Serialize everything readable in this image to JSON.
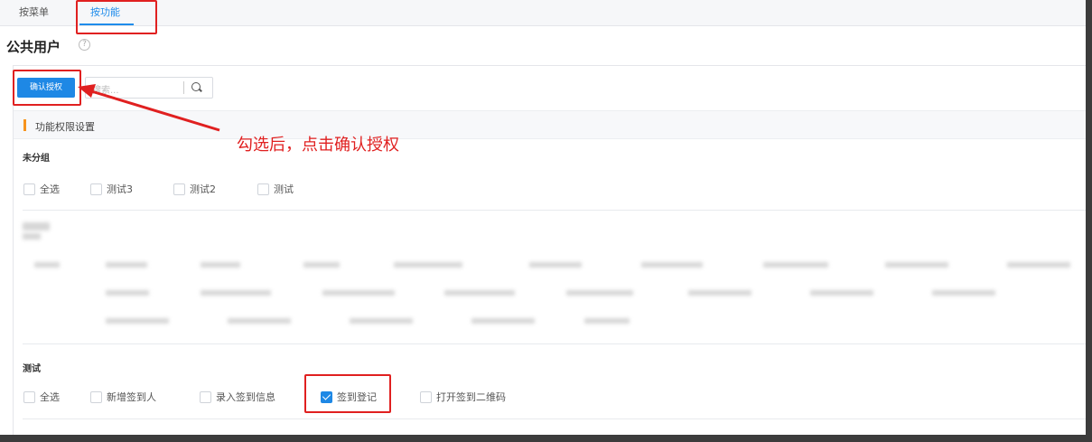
{
  "tabs": [
    {
      "label": "按菜单"
    },
    {
      "label": "按功能"
    }
  ],
  "page_title": "公共用户",
  "toolbar": {
    "confirm_label": "确认授权",
    "search_placeholder": "搜索..."
  },
  "section": {
    "label": "功能权限设置"
  },
  "groups": [
    {
      "title": "未分组",
      "items": [
        {
          "label": "全选",
          "checked": false
        },
        {
          "label": "测试3",
          "checked": false
        },
        {
          "label": "测试2",
          "checked": false
        },
        {
          "label": "测试",
          "checked": false
        }
      ]
    },
    {
      "title": "测试",
      "items": [
        {
          "label": "全选",
          "checked": false
        },
        {
          "label": "新增签到人",
          "checked": false
        },
        {
          "label": "录入签到信息",
          "checked": false
        },
        {
          "label": "签到登记",
          "checked": true
        },
        {
          "label": "打开签到二维码",
          "checked": false
        }
      ]
    }
  ],
  "annotation": {
    "text": "勾选后，点击确认授权",
    "color": "#e02020"
  },
  "colors": {
    "accent": "#1e88e5",
    "section_bar": "#f7941e"
  }
}
